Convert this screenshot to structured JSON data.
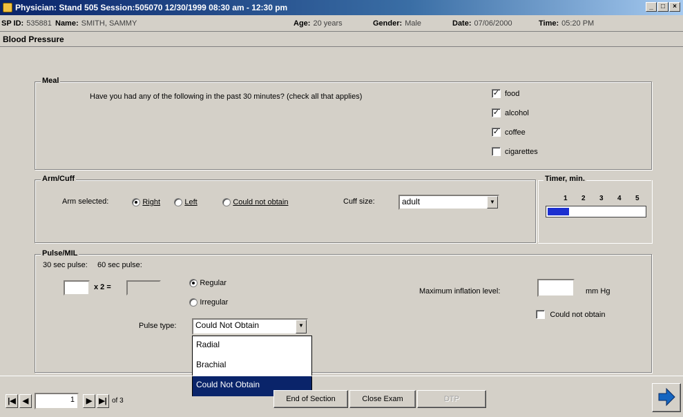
{
  "window": {
    "title": "Physician: Stand 505 Session:505070 12/30/1999 08:30 am - 12:30 pm",
    "minimize": "_",
    "maximize": "□",
    "close": "×"
  },
  "info": {
    "sp_id_label": "SP ID:",
    "sp_id": "535881",
    "name_label": "Name:",
    "name": "SMITH, SAMMY",
    "age_label": "Age:",
    "age": "20 years",
    "gender_label": "Gender:",
    "gender": "Male",
    "date_label": "Date:",
    "date": "07/06/2000",
    "time_label": "Time:",
    "time": "05:20 PM"
  },
  "section_title": "Blood Pressure",
  "meal": {
    "label": "Meal",
    "question": "Have you had any of the following in the past 30 minutes? (check all that applies)",
    "options": [
      {
        "label": "food",
        "checked": true
      },
      {
        "label": "alcohol",
        "checked": true
      },
      {
        "label": "coffee",
        "checked": true
      },
      {
        "label": "cigarettes",
        "checked": false
      }
    ]
  },
  "arm_cuff": {
    "label": "Arm/Cuff",
    "arm_label": "Arm selected:",
    "arm_options": [
      "Right",
      "Left",
      "Could not obtain"
    ],
    "arm_selected": "Right",
    "cuff_label": "Cuff size:",
    "cuff_value": "adult"
  },
  "timer": {
    "label": "Timer, min.",
    "ticks": [
      "1",
      "2",
      "3",
      "4",
      "5"
    ],
    "progress": 0.22
  },
  "pulse": {
    "label": "Pulse/MIL",
    "pulse30_label": "30 sec pulse:",
    "pulse60_label": "60 sec pulse:",
    "multiplier": "x 2 =",
    "rhythm_options": [
      "Regular",
      "Irregular"
    ],
    "rhythm_selected": "Regular",
    "pulse_type_label": "Pulse type:",
    "pulse_type_value": "Could Not Obtain",
    "pulse_type_options": [
      "Radial",
      "Brachial",
      "Could Not Obtain"
    ],
    "mil_label": "Maximum inflation level:",
    "mil_unit": "mm Hg",
    "mil_could_not_obtain": "Could not obtain"
  },
  "nav": {
    "page": "1",
    "of_label": "of 3",
    "end_section": "End of Section",
    "close_exam": "Close Exam",
    "disabled_button": "DTP"
  }
}
